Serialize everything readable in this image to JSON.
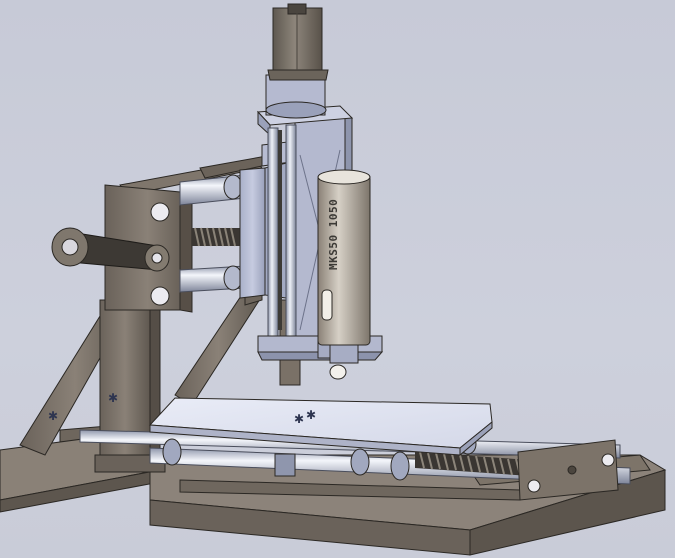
{
  "scene": {
    "subject": "cnc-mill-cad-model",
    "background_color": "#c9ccd8",
    "frame_color": "#7a7167",
    "rail_color": "#b9bfcf",
    "table_color": "#e6e9f4",
    "spring_color": "#3a3632"
  },
  "spindle_motor": {
    "label_text": "MKS50 1050"
  },
  "icons": [
    "pulley-icon",
    "spring-icon",
    "origin-marker-icon"
  ]
}
